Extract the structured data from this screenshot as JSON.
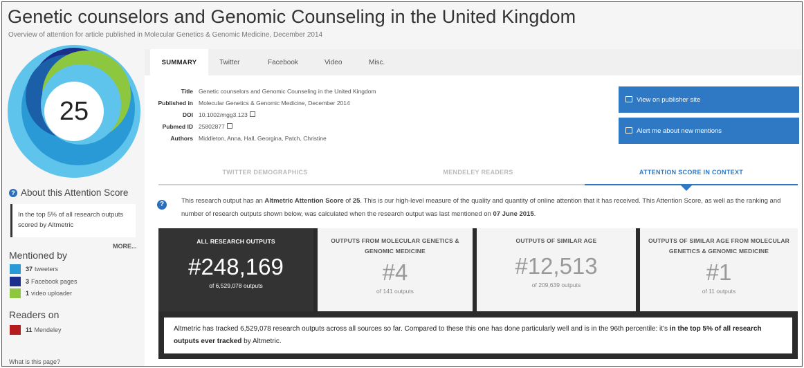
{
  "header": {
    "title": "Genetic counselors and Genomic Counseling in the United Kingdom",
    "subtitle": "Overview of attention for article published in Molecular Genetics & Genomic Medicine, December 2014"
  },
  "donut": {
    "score": "25",
    "colors": [
      "#5ec4ec",
      "#2a9ad6",
      "#1b5fa8",
      "#1a2f8c",
      "#8dc63f"
    ]
  },
  "sidebar": {
    "about_label": "About this Attention Score",
    "top_text": "In the top 5% of all research outputs scored by Altmetric",
    "more": "MORE...",
    "mentioned_heading": "Mentioned by",
    "mentions": [
      {
        "count": "37",
        "label": "tweeters",
        "color": "#2a9ad6"
      },
      {
        "count": "3",
        "label": "Facebook pages",
        "color": "#1a2f8c"
      },
      {
        "count": "1",
        "label": "video uploader",
        "color": "#8dc63f"
      }
    ],
    "readers_heading": "Readers on",
    "readers": [
      {
        "count": "11",
        "label": "Mendeley",
        "color": "#b71c1c"
      }
    ],
    "what_link": "What is this page?"
  },
  "tabs": [
    "SUMMARY",
    "Twitter",
    "Facebook",
    "Video",
    "Misc."
  ],
  "meta": {
    "title_key": "Title",
    "title_val": "Genetic counselors and Genomic Counseling in the United Kingdom",
    "published_key": "Published in",
    "published_val": "Molecular Genetics & Genomic Medicine, December 2014",
    "doi_key": "DOI",
    "doi_val": "10.1002/mgg3.123",
    "pubmed_key": "Pubmed ID",
    "pubmed_val": "25802877",
    "authors_key": "Authors",
    "authors_val": "Middleton, Anna, Hall, Georgina, Patch, Christine"
  },
  "buttons": {
    "publisher": "View on publisher site",
    "alert": "Alert me about new mentions"
  },
  "subtabs": [
    "TWITTER DEMOGRAPHICS",
    "MENDELEY READERS",
    "ATTENTION SCORE IN CONTEXT"
  ],
  "info": {
    "p1": "This research output has an ",
    "b1": "Altmetric Attention Score",
    "p2": " of ",
    "b2": "25",
    "p3": ". This is our high-level measure of the quality and quantity of online attention that it has received. This Attention Score, as well as the ranking and number of research outputs shown below, was calculated when the research output was last mentioned on ",
    "b3": "07 June 2015",
    "p4": "."
  },
  "cards": [
    {
      "heading": "ALL RESEARCH OUTPUTS",
      "rank": "#248,169",
      "of": "of 6,529,078 outputs"
    },
    {
      "heading": "OUTPUTS FROM MOLECULAR GENETICS & GENOMIC MEDICINE",
      "rank": "#4",
      "of": "of 141 outputs"
    },
    {
      "heading": "OUTPUTS OF SIMILAR AGE",
      "rank": "#12,513",
      "of": "of 209,639 outputs"
    },
    {
      "heading": "OUTPUTS OF SIMILAR AGE FROM MOLECULAR GENETICS & GENOMIC MEDICINE",
      "rank": "#1",
      "of": "of 11 outputs"
    }
  ],
  "summary": {
    "p1": "Altmetric has tracked 6,529,078 research outputs across all sources so far. Compared to these this one has done particularly well and is in the 96th percentile: it's ",
    "b1": "in the top 5% of all research outputs ever tracked",
    "p2": " by Altmetric."
  }
}
